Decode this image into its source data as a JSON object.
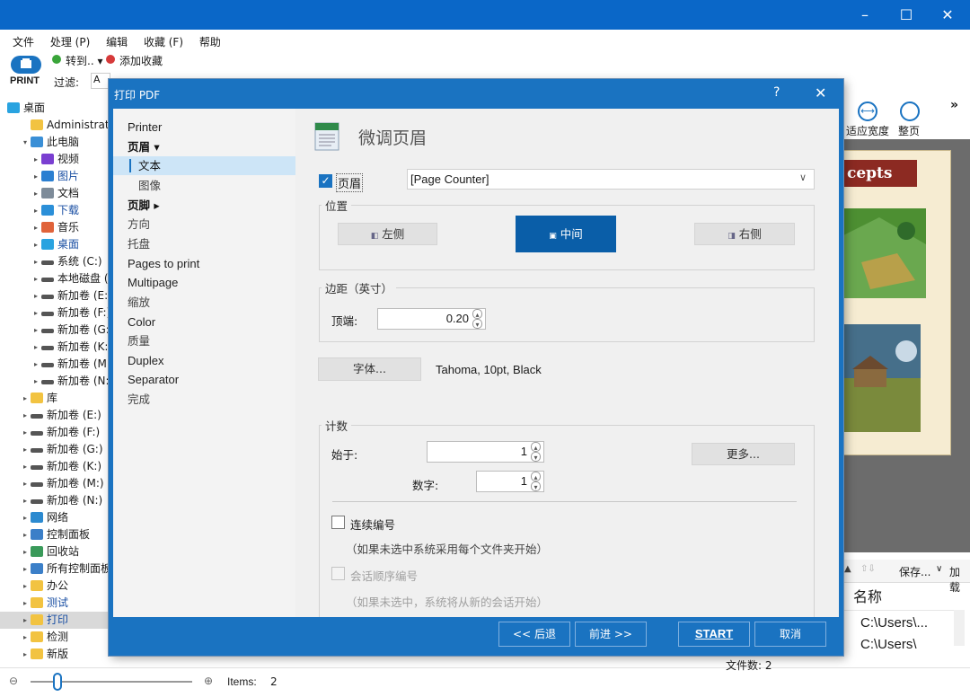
{
  "window": {
    "controls": [
      "–",
      "☐",
      "✕"
    ]
  },
  "menu": [
    "文件",
    "处理 (P)",
    "编辑",
    "收藏 (F)",
    "帮助"
  ],
  "toolbar": {
    "print_label": "PRINT",
    "goto_label": "转到..",
    "favorite_label": "添加收藏",
    "filter_label": "过滤:",
    "filter_value": "A"
  },
  "tree": [
    {
      "label": "桌面",
      "icon": "desktop"
    },
    {
      "label": "Administrator",
      "icon": "folder"
    },
    {
      "label": "此电脑",
      "icon": "pc"
    },
    {
      "label": "视频",
      "icon": "video"
    },
    {
      "label": "图片",
      "icon": "image"
    },
    {
      "label": "文档",
      "icon": "doc"
    },
    {
      "label": "下载",
      "icon": "download"
    },
    {
      "label": "音乐",
      "icon": "music"
    },
    {
      "label": "桌面",
      "icon": "desktop"
    },
    {
      "label": "系统 (C:)",
      "icon": "drive"
    },
    {
      "label": "本地磁盘 (D:",
      "icon": "drive"
    },
    {
      "label": "新加卷 (E:)",
      "icon": "drive"
    },
    {
      "label": "新加卷 (F:)",
      "icon": "drive"
    },
    {
      "label": "新加卷 (G:)",
      "icon": "drive"
    },
    {
      "label": "新加卷 (K:)",
      "icon": "drive"
    },
    {
      "label": "新加卷 (M:)",
      "icon": "drive"
    },
    {
      "label": "新加卷 (N:)",
      "icon": "drive"
    },
    {
      "label": "库",
      "icon": "folder"
    },
    {
      "label": "新加卷 (E:)",
      "icon": "drive"
    },
    {
      "label": "新加卷 (F:)",
      "icon": "drive"
    },
    {
      "label": "新加卷 (G:)",
      "icon": "drive"
    },
    {
      "label": "新加卷 (K:)",
      "icon": "drive"
    },
    {
      "label": "新加卷 (M:)",
      "icon": "drive"
    },
    {
      "label": "新加卷 (N:)",
      "icon": "drive"
    },
    {
      "label": "网络",
      "icon": "network"
    },
    {
      "label": "控制面板",
      "icon": "control"
    },
    {
      "label": "回收站",
      "icon": "recycle"
    },
    {
      "label": "所有控制面板项",
      "icon": "control"
    },
    {
      "label": "办公",
      "icon": "folder"
    },
    {
      "label": "测试",
      "icon": "folder"
    },
    {
      "label": "打印",
      "icon": "folder"
    },
    {
      "label": "检测",
      "icon": "folder"
    },
    {
      "label": "新版",
      "icon": "folder"
    }
  ],
  "right_pane": {
    "fit_width_label": "适应宽度",
    "full_page_label": "整页",
    "banner_text": "cepts",
    "save_label": "保存...",
    "add_label": "加载",
    "name_column": "名称",
    "rows": [
      "C:\\Users\\...",
      "C:\\Users\\"
    ]
  },
  "status": {
    "items_label": "Items:",
    "items_count": "2",
    "file_count_label": "文件数:",
    "file_count": "2"
  },
  "dialog": {
    "title": "打印 PDF",
    "help": "?",
    "close": "✕",
    "nav": [
      {
        "label": "Printer"
      },
      {
        "label": "页眉"
      },
      {
        "label": "文本"
      },
      {
        "label": "图像"
      },
      {
        "label": "页脚"
      },
      {
        "label": "方向"
      },
      {
        "label": "托盘"
      },
      {
        "label": "Pages to print"
      },
      {
        "label": "Multipage"
      },
      {
        "label": "缩放"
      },
      {
        "label": "Color"
      },
      {
        "label": "质量"
      },
      {
        "label": "Duplex"
      },
      {
        "label": "Separator"
      },
      {
        "label": "完成"
      }
    ],
    "heading": "微调页眉",
    "header_checkbox_label": "页眉",
    "header_select_value": "[Page Counter]",
    "position": {
      "label": "位置",
      "left": "左侧",
      "center": "中间",
      "right": "右侧"
    },
    "margin": {
      "label": "边距（英寸）",
      "top_label": "顶端:",
      "top_value": "0.20"
    },
    "font": {
      "button": "字体...",
      "value": "Tahoma, 10pt, Black"
    },
    "counter": {
      "label": "计数",
      "start_label": "始于:",
      "start_value": "1",
      "digits_label": "数字:",
      "digits_value": "1",
      "more_button": "更多...",
      "continuous_label": "连续编号",
      "continuous_note": "（如果未选中系统采用每个文件夹开始）",
      "session_label": "会话顺序编号",
      "session_note": "（如果未选中，系统将从新的会话开始）"
    },
    "footer": {
      "back": "<< 后退",
      "next": "前进 >>",
      "start": "START",
      "cancel": "取消"
    }
  },
  "colors": {
    "title_blue": "#0a67c8",
    "dialog_blue": "#1a73c1",
    "accent_blue": "#0a5ea8"
  }
}
